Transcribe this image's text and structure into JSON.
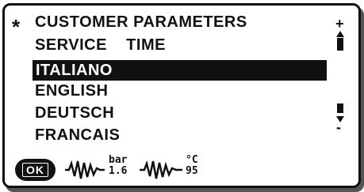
{
  "menu": {
    "header_marker": "*",
    "items": [
      {
        "label": "CUSTOMER PARAMETERS"
      },
      {
        "label": "SERVICE    TIME"
      },
      {
        "label": "ITALIANO",
        "selected": true
      },
      {
        "label": "ENGLISH"
      },
      {
        "label": "DEUTSCH"
      },
      {
        "label": "FRANCAIS"
      }
    ]
  },
  "scroll": {
    "up_symbol": "+",
    "down_symbol": "-"
  },
  "status_bar": {
    "ok_label": "OK",
    "pressure": {
      "unit": "bar",
      "value": "1.6"
    },
    "temperature": {
      "unit": "°C",
      "value": "95"
    }
  },
  "colors": {
    "foreground": "#111111",
    "background": "#ffffff",
    "shadow": "#555555"
  },
  "icons": [
    "selected-marker-icon",
    "scroll-up-icon",
    "scroll-down-icon",
    "signal-wave-icon",
    "signal-wave-icon"
  ]
}
